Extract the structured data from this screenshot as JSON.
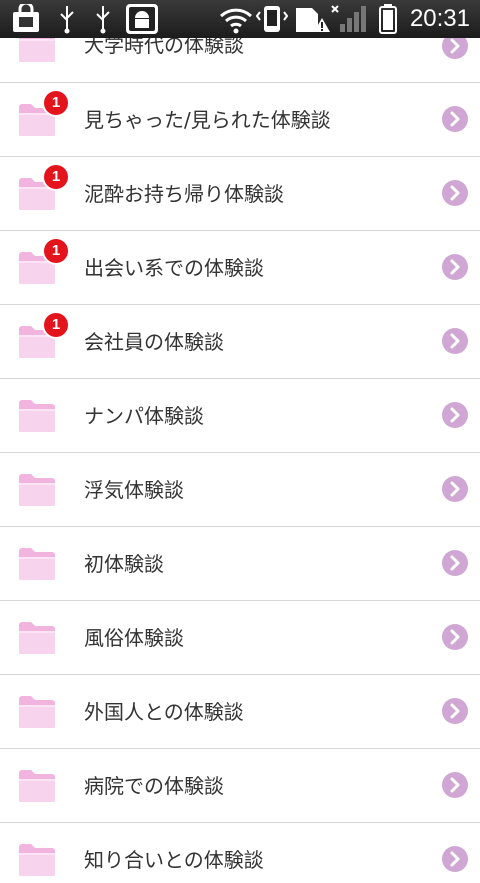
{
  "status_bar": {
    "time": "20:31"
  },
  "list": {
    "items": [
      {
        "label": "大学時代の体験談",
        "badge": ""
      },
      {
        "label": "見ちゃった/見られた体験談",
        "badge": "1"
      },
      {
        "label": "泥酔お持ち帰り体験談",
        "badge": "1"
      },
      {
        "label": "出会い系での体験談",
        "badge": "1"
      },
      {
        "label": "会社員の体験談",
        "badge": "1"
      },
      {
        "label": "ナンパ体験談",
        "badge": ""
      },
      {
        "label": "浮気体験談",
        "badge": ""
      },
      {
        "label": "初体験談",
        "badge": ""
      },
      {
        "label": "風俗体験談",
        "badge": ""
      },
      {
        "label": "外国人との体験談",
        "badge": ""
      },
      {
        "label": "病院での体験談",
        "badge": ""
      },
      {
        "label": "知り合いとの体験談",
        "badge": ""
      }
    ]
  },
  "colors": {
    "folder": "#f5c6e8",
    "chevron": "#cfa6d4",
    "badge": "#e3141b"
  }
}
